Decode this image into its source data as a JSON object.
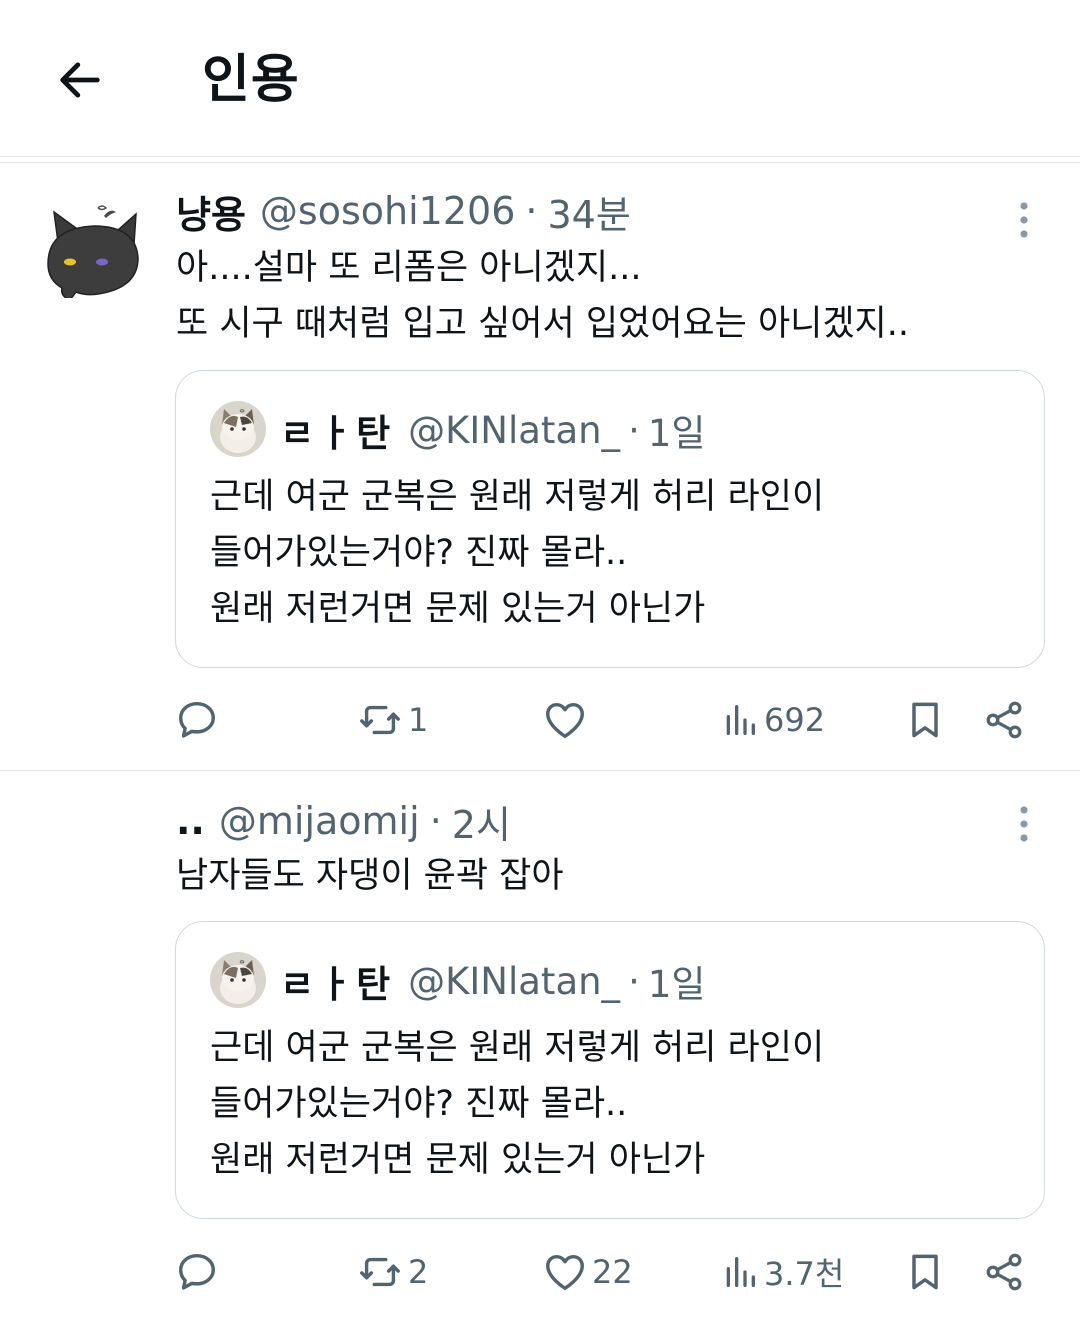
{
  "header": {
    "title": "인용"
  },
  "tweets": [
    {
      "name": "냥용",
      "handle": "@sosohi1206",
      "dot": "·",
      "time": "34분",
      "lines": [
        "아....설마 또 리폼은 아니겠지...",
        "또 시구 때처럼 입고 싶어서 입었어요는 아니겠지.."
      ],
      "quote": {
        "name": "ㄹㅏ탄",
        "handle": "@KINlatan_",
        "dot": "·",
        "time": "1일",
        "lines": [
          "근데 여군 군복은 원래 저렇게 허리 라인이",
          "들어가있는거야? 진짜 몰라..",
          "원래 저런거면 문제 있는거 아닌가"
        ]
      },
      "actions": {
        "reply": "",
        "retweet": "1",
        "like": "",
        "views": "692"
      }
    },
    {
      "name": "..",
      "handle": "@mijaomij",
      "dot": "·",
      "time": "2시",
      "lines": [
        "남자들도 자댕이 윤곽 잡아"
      ],
      "quote": {
        "name": "ㄹㅏ탄",
        "handle": "@KINlatan_",
        "dot": "·",
        "time": "1일",
        "lines": [
          "근데 여군 군복은 원래 저렇게 허리 라인이",
          "들어가있는거야? 진짜 몰라..",
          "원래 저런거면 문제 있는거 아닌가"
        ]
      },
      "actions": {
        "reply": "",
        "retweet": "2",
        "like": "22",
        "views": "3.7천"
      }
    }
  ],
  "colors": {
    "text": "#0f1419",
    "secondary": "#536471",
    "border": "#cfd9de",
    "divider": "#e3e6e9"
  },
  "icons": [
    "arrow-left-icon",
    "more-vertical-icon",
    "reply-icon",
    "retweet-icon",
    "heart-icon",
    "views-icon",
    "bookmark-icon",
    "share-icon"
  ]
}
